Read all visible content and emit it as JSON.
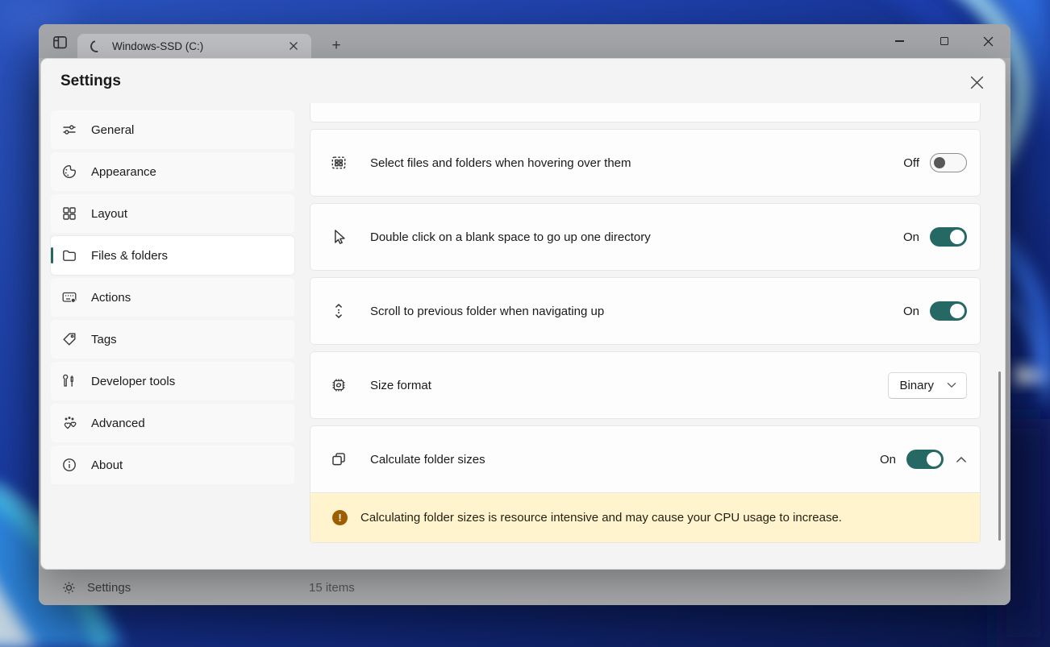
{
  "colors": {
    "accent": "#266863",
    "warning-bg": "#fff4ce",
    "warning-icon": "#9d5d00"
  },
  "window": {
    "tab_title": "Windows-SSD (C:)",
    "statusbar": {
      "settings_label": "Settings",
      "items_count": "15 items"
    }
  },
  "dialog": {
    "title": "Settings",
    "sidebar": {
      "items": [
        {
          "label": "General",
          "icon": "sliders-icon"
        },
        {
          "label": "Appearance",
          "icon": "palette-icon"
        },
        {
          "label": "Layout",
          "icon": "grid-icon"
        },
        {
          "label": "Files & folders",
          "icon": "folder-icon",
          "selected": true
        },
        {
          "label": "Actions",
          "icon": "keyboard-gear-icon"
        },
        {
          "label": "Tags",
          "icon": "tag-icon"
        },
        {
          "label": "Developer tools",
          "icon": "tools-icon"
        },
        {
          "label": "Advanced",
          "icon": "hearts-icon"
        },
        {
          "label": "About",
          "icon": "info-icon"
        }
      ]
    },
    "rows": [
      {
        "icon": "multi-select-icon",
        "label": "Select files and folders when hovering over them",
        "control": "toggle",
        "state": "Off"
      },
      {
        "icon": "cursor-icon",
        "label": "Double click on a blank space to go up one directory",
        "control": "toggle",
        "state": "On"
      },
      {
        "icon": "scroll-icon",
        "label": "Scroll to previous folder when navigating up",
        "control": "toggle",
        "state": "On"
      },
      {
        "icon": "chip-sync-icon",
        "label": "Size format",
        "control": "dropdown",
        "value": "Binary"
      },
      {
        "icon": "copy-squares-icon",
        "label": "Calculate folder sizes",
        "control": "toggle",
        "state": "On",
        "expanded": true
      }
    ],
    "warning": {
      "text": "Calculating folder sizes is resource intensive and may cause your CPU usage to increase."
    }
  }
}
